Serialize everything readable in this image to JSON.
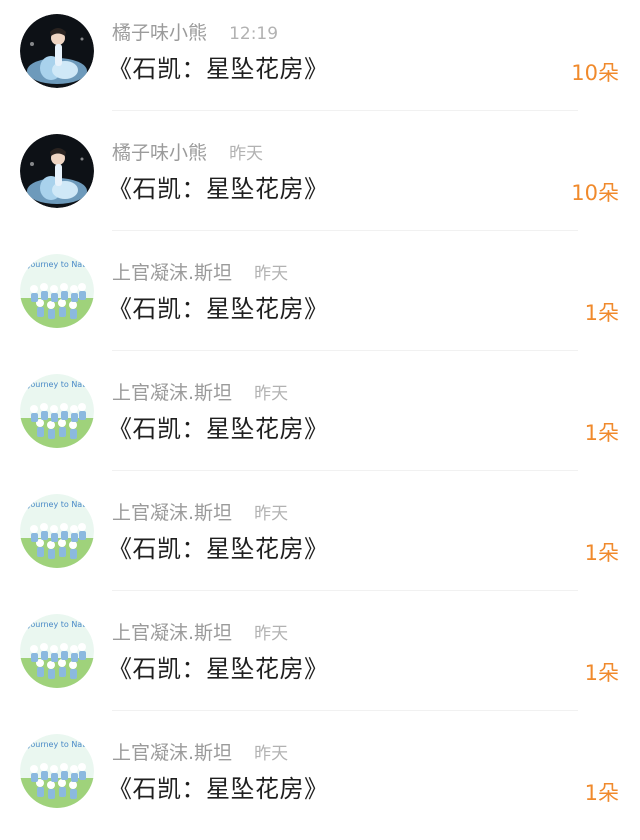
{
  "items": [
    {
      "user": "橘子味小熊",
      "time": "12:19",
      "title": "《石凯：星坠花房》",
      "count": "10朵",
      "avatar": "dark-stage-avatar"
    },
    {
      "user": "橘子味小熊",
      "time": "昨天",
      "title": "《石凯：星坠花房》",
      "count": "10朵",
      "avatar": "dark-stage-avatar"
    },
    {
      "user": "上官凝沫.斯坦",
      "time": "昨天",
      "title": "《石凯：星坠花房》",
      "count": "1朵",
      "avatar": "journey-to-nature-avatar",
      "avatar_text": "Journey to Nature"
    },
    {
      "user": "上官凝沫.斯坦",
      "time": "昨天",
      "title": "《石凯：星坠花房》",
      "count": "1朵",
      "avatar": "journey-to-nature-avatar",
      "avatar_text": "Journey to Nature"
    },
    {
      "user": "上官凝沫.斯坦",
      "time": "昨天",
      "title": "《石凯：星坠花房》",
      "count": "1朵",
      "avatar": "journey-to-nature-avatar",
      "avatar_text": "Journey to Nature"
    },
    {
      "user": "上官凝沫.斯坦",
      "time": "昨天",
      "title": "《石凯：星坠花房》",
      "count": "1朵",
      "avatar": "journey-to-nature-avatar",
      "avatar_text": "Journey to Nature"
    },
    {
      "user": "上官凝沫.斯坦",
      "time": "昨天",
      "title": "《石凯：星坠花房》",
      "count": "1朵",
      "avatar": "journey-to-nature-avatar",
      "avatar_text": "Journey to Nature"
    }
  ],
  "colors": {
    "accent": "#f08a2c",
    "title": "#1f1f1f",
    "meta": "#9b9b9b",
    "divider": "#f1f1f1"
  }
}
